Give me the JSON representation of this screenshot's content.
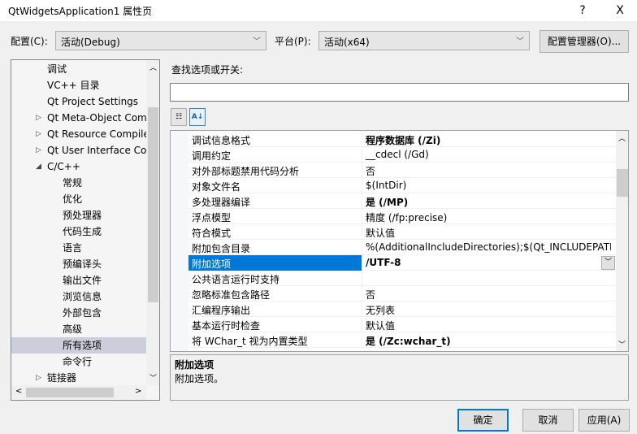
{
  "window": {
    "title": "QtWidgetsApplication1 属性页",
    "help": "?",
    "close": "X"
  },
  "config": {
    "label": "配置(C):",
    "value": "活动(Debug)"
  },
  "platform": {
    "label": "平台(P):",
    "value": "活动(x64)"
  },
  "config_manager": "配置管理器(O)...",
  "tree": {
    "items": [
      {
        "label": "调试",
        "level": 1
      },
      {
        "label": "VC++ 目录",
        "level": 1
      },
      {
        "label": "Qt Project Settings",
        "level": 1
      },
      {
        "label": "Qt Meta-Object Compiler",
        "level": 1,
        "expander": "collapsed"
      },
      {
        "label": "Qt Resource Compiler",
        "level": 1,
        "expander": "collapsed"
      },
      {
        "label": "Qt User Interface Compiler",
        "level": 1,
        "expander": "collapsed"
      },
      {
        "label": "C/C++",
        "level": 1,
        "expander": "expanded"
      },
      {
        "label": "常规",
        "level": 2
      },
      {
        "label": "优化",
        "level": 2
      },
      {
        "label": "预处理器",
        "level": 2
      },
      {
        "label": "代码生成",
        "level": 2
      },
      {
        "label": "语言",
        "level": 2
      },
      {
        "label": "预编译头",
        "level": 2
      },
      {
        "label": "输出文件",
        "level": 2
      },
      {
        "label": "浏览信息",
        "level": 2
      },
      {
        "label": "外部包含",
        "level": 2
      },
      {
        "label": "高级",
        "level": 2
      },
      {
        "label": "所有选项",
        "level": 2,
        "selected": true
      },
      {
        "label": "命令行",
        "level": 2
      },
      {
        "label": "链接器",
        "level": 1,
        "expander": "collapsed"
      }
    ]
  },
  "search": {
    "label": "查找选项或开关:",
    "value": ""
  },
  "toolbar": {
    "categorized": "categorized-icon",
    "alphabetical": "sort-az-icon"
  },
  "properties": [
    {
      "name": "调试信息格式",
      "value": "程序数据库 (/Zi)",
      "bold": true
    },
    {
      "name": "调用约定",
      "value": "__cdecl (/Gd)"
    },
    {
      "name": "对外部标题禁用代码分析",
      "value": "否"
    },
    {
      "name": "对象文件名",
      "value": "$(IntDir)"
    },
    {
      "name": "多处理器编译",
      "value": "是 (/MP)",
      "bold": true
    },
    {
      "name": "浮点模型",
      "value": "精度 (/fp:precise)"
    },
    {
      "name": "符合模式",
      "value": "默认值"
    },
    {
      "name": "附加包含目录",
      "value": "%(AdditionalIncludeDirectories);$(Qt_INCLUDEPATH_)"
    },
    {
      "name": "附加选项",
      "value": "/UTF-8",
      "bold": true,
      "selected": true
    },
    {
      "name": "公共语言运行时支持",
      "value": ""
    },
    {
      "name": "忽略标准包含路径",
      "value": "否"
    },
    {
      "name": "汇编程序输出",
      "value": "无列表"
    },
    {
      "name": "基本运行时检查",
      "value": "默认值"
    },
    {
      "name": "将 WChar_t 视为内置类型",
      "value": "是 (/Zc:wchar_t)",
      "bold": true
    }
  ],
  "description": {
    "title": "附加选项",
    "text": "附加选项。"
  },
  "buttons": {
    "ok": "确定",
    "cancel": "取消",
    "apply": "应用(A)"
  },
  "colors": {
    "selection": "#0078d7",
    "tree_selection": "#cccedb",
    "default_button_border": "#0078d7"
  }
}
